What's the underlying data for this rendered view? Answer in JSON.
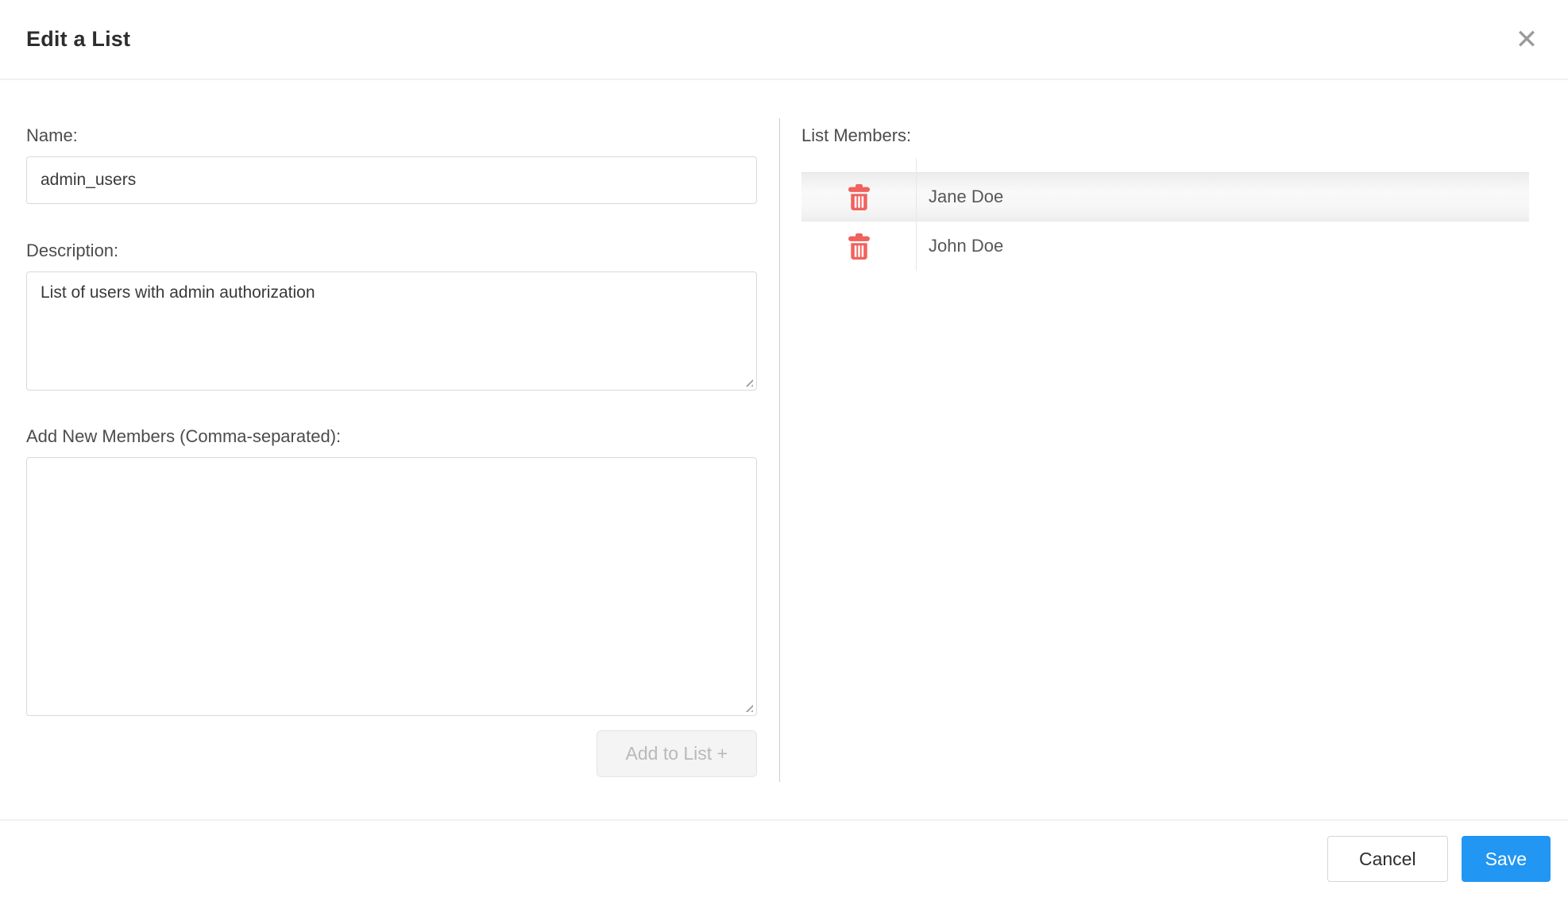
{
  "dialog": {
    "title": "Edit a List"
  },
  "icons": {
    "close": "✕"
  },
  "form": {
    "name": {
      "label": "Name:",
      "value": "admin_users"
    },
    "description": {
      "label": "Description:",
      "value": "List of users with admin authorization"
    },
    "new_members": {
      "label": "Add New Members (Comma-separated):",
      "value": ""
    },
    "add_button_label": "Add to List +"
  },
  "members": {
    "label": "List Members:",
    "items": [
      {
        "name": "Jane Doe"
      },
      {
        "name": "John Doe"
      }
    ]
  },
  "footer": {
    "cancel_label": "Cancel",
    "save_label": "Save"
  },
  "colors": {
    "accent": "#2196f3",
    "danger": "#f0625d"
  }
}
